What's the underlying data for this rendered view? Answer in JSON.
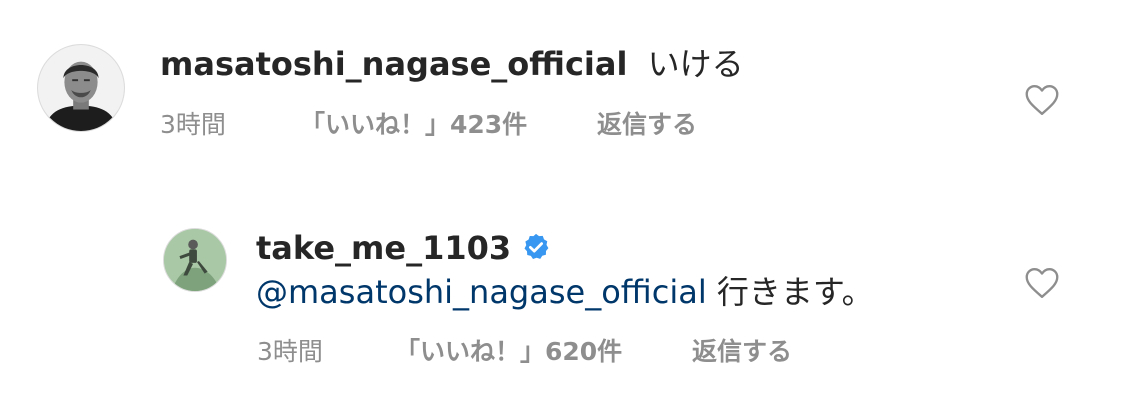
{
  "comments": [
    {
      "username": "masatoshi_nagase_official",
      "text": "いける",
      "time": "3時間",
      "likes": "「いいね！」423件",
      "reply_label": "返信する",
      "verified": false
    },
    {
      "username": "take_me_1103",
      "mention": "@masatoshi_nagase_official",
      "text": " 行きます。",
      "time": "3時間",
      "likes": "「いいね！」620件",
      "reply_label": "返信する",
      "verified": true
    }
  ],
  "colors": {
    "text": "#262626",
    "secondary": "#8e8e8e",
    "mention": "#00376b",
    "verified": "#3897f0"
  },
  "icons": {
    "like": "heart-outline-icon",
    "verified": "verified-badge-icon"
  }
}
